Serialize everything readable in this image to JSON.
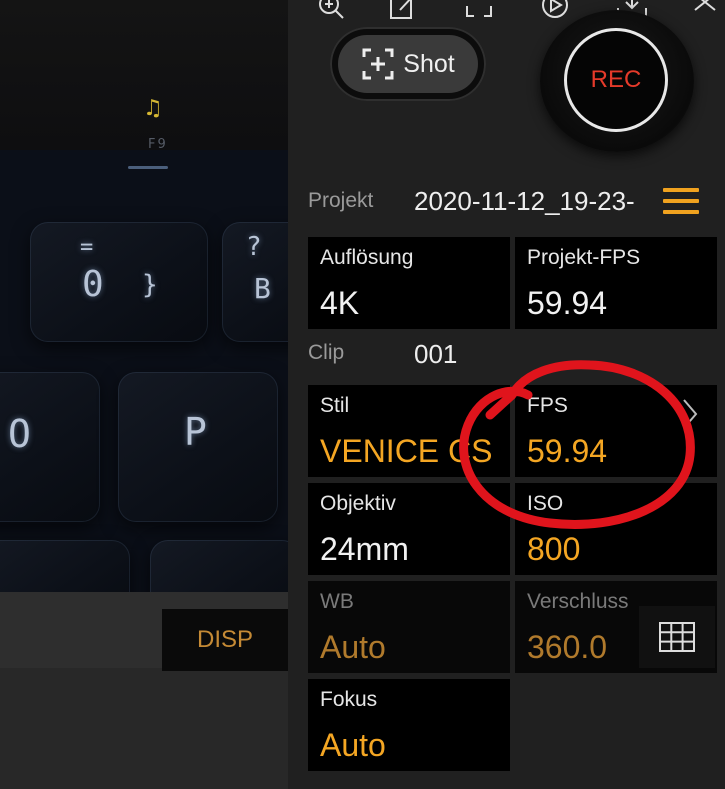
{
  "toolbar": {
    "icons": [
      "zoom-in-icon",
      "edit-icon",
      "frame-icon",
      "play-icon",
      "download-icon",
      "close-icon"
    ]
  },
  "shot_button": {
    "label": "Shot",
    "icon": "capture-icon"
  },
  "rec_button": {
    "label": "REC"
  },
  "project": {
    "label": "Projekt",
    "value": "2020-11-12_19-23-"
  },
  "clip": {
    "label": "Clip",
    "value": "001"
  },
  "cells": {
    "resolution": {
      "label": "Auflösung",
      "value": "4K"
    },
    "project_fps": {
      "label": "Projekt-FPS",
      "value": "59.94"
    },
    "style": {
      "label": "Stil",
      "value": "VENICE CS"
    },
    "fps": {
      "label": "FPS",
      "value": "59.94"
    },
    "lens": {
      "label": "Objektiv",
      "value": "24mm"
    },
    "iso": {
      "label": "ISO",
      "value": "800"
    },
    "wb": {
      "label": "WB",
      "value": "Auto"
    },
    "shutter": {
      "label": "Verschluss",
      "value": "360.0"
    },
    "focus": {
      "label": "Fokus",
      "value": "Auto"
    }
  },
  "disp_button": {
    "label": "DISP"
  },
  "preview": {
    "key_labels": [
      "F9",
      "=",
      "0",
      "}",
      "?",
      "B",
      "O",
      "P"
    ]
  },
  "colors": {
    "accent": "#f4a623",
    "rec_red": "#e53a2a",
    "annotation_red": "#e0141c"
  }
}
